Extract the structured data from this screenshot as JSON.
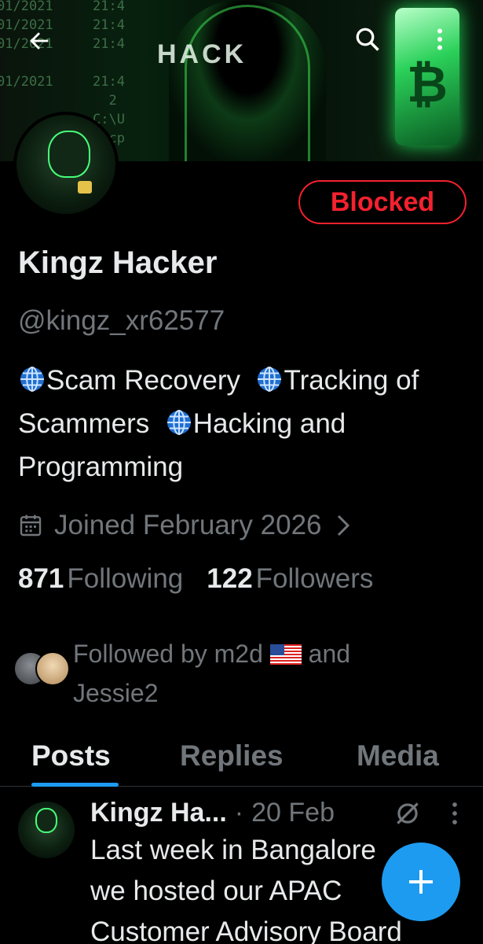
{
  "profile": {
    "name": "Kingz Hacker",
    "handle": "@kingz_xr62577",
    "blocked_label": "Blocked",
    "bio": {
      "part1": "Scam Recovery",
      "part2": "Tracking of Scammers",
      "part3": "Hacking and Programming"
    },
    "joined": "Joined February 2026",
    "following_count": "871",
    "following_label": "Following",
    "followers_count": "122",
    "followers_label": "Followers",
    "followed_by_prefix": "Followed by m2d",
    "followed_by_suffix": "and Jessie2"
  },
  "banner": {
    "word": "HACK"
  },
  "tabs": [
    {
      "label": "Posts",
      "active": true
    },
    {
      "label": "Replies",
      "active": false
    },
    {
      "label": "Media",
      "active": false
    }
  ],
  "post": {
    "author": "Kingz Ha...",
    "date": "20 Feb",
    "text": "Last week in Bangalore\nwe hosted our APAC\nCustomer Advisory Board"
  },
  "icons": {
    "back": "arrow-left-icon",
    "search": "search-icon",
    "more": "more-vertical-icon",
    "calendar": "calendar-icon",
    "chevron": "chevron-right-icon",
    "globe": "globe-icon",
    "compose": "plus-icon"
  },
  "colors": {
    "accent": "#1d9bf0",
    "blocked": "#f4212e",
    "secondary_text": "#71767b"
  }
}
